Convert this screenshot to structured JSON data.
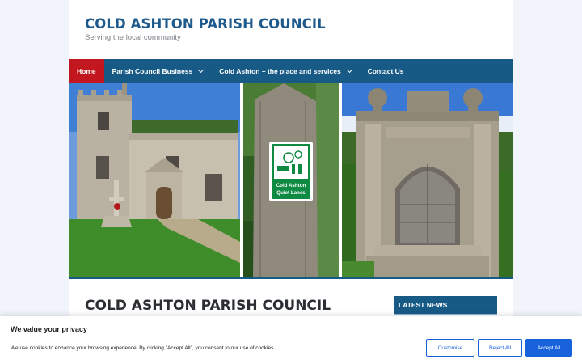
{
  "header": {
    "site_title": "COLD ASHTON PARISH COUNCIL",
    "tagline": "Serving the local community"
  },
  "nav": {
    "items": [
      {
        "label": "Home",
        "active": true
      },
      {
        "label": "Parish Council Business",
        "has_dropdown": true
      },
      {
        "label": "Cold Ashton – the place and services",
        "has_dropdown": true
      },
      {
        "label": "Contact Us"
      }
    ]
  },
  "hero": {
    "sign_line1": "Cold Ashton",
    "sign_line2": "‘Quiet Lanes’"
  },
  "main": {
    "heading": "COLD ASHTON PARISH COUNCIL"
  },
  "sidebar": {
    "widget_title": "LATEST NEWS"
  },
  "cookie_banner": {
    "title": "We value your privacy",
    "text": "We use cookies to enhance your browsing experience. By clicking \"Accept All\", you consent to our use of cookies.",
    "customise_label": "Customise",
    "reject_label": "Reject All",
    "accept_label": "Accept All"
  },
  "colors": {
    "brand_blue": "#175a85",
    "title_blue": "#1e5a8c",
    "active_red": "#c2171f",
    "cookie_blue": "#1863dc"
  }
}
